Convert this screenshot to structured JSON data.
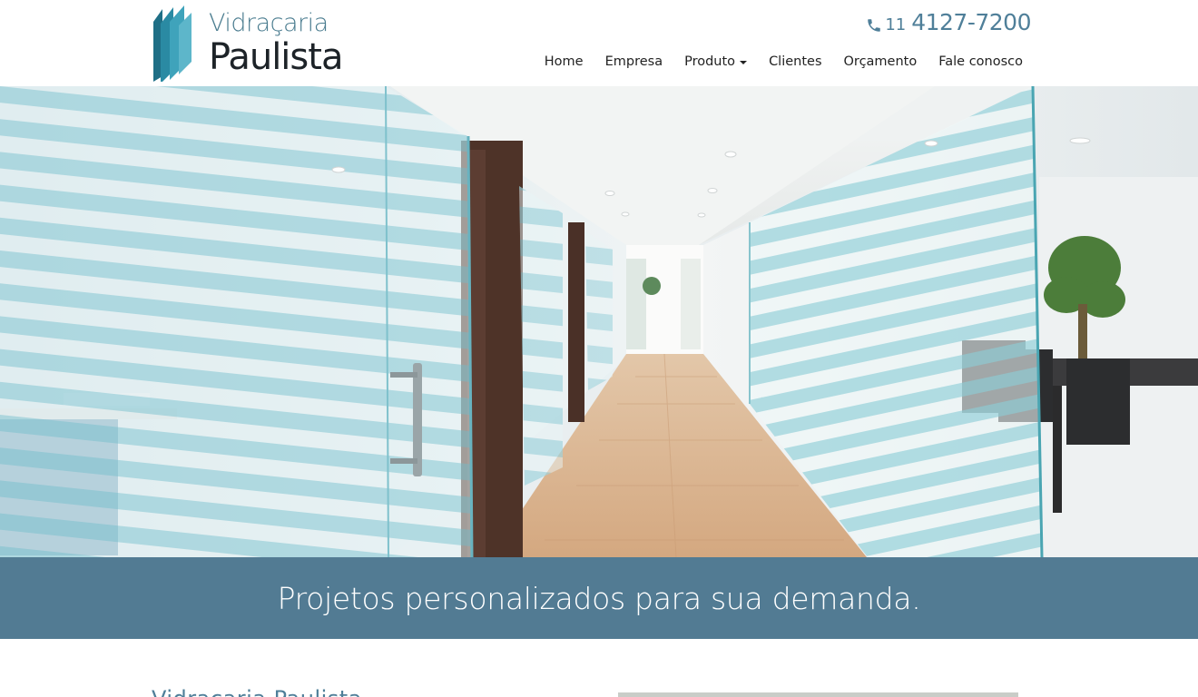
{
  "brand": {
    "line1": "Vidraçaria",
    "line2": "Paulista"
  },
  "contact": {
    "phone_icon": "phone-icon",
    "area_code": "11",
    "number": "4127-7200"
  },
  "nav": {
    "items": [
      {
        "label": "Home",
        "dropdown": false
      },
      {
        "label": "Empresa",
        "dropdown": false
      },
      {
        "label": "Produto",
        "dropdown": true
      },
      {
        "label": "Clientes",
        "dropdown": false
      },
      {
        "label": "Orçamento",
        "dropdown": false
      },
      {
        "label": "Fale conosco",
        "dropdown": false
      }
    ]
  },
  "hero": {
    "image": "office-corridor-with-striped-glass-partitions"
  },
  "banner": {
    "text": "Projetos personalizados para sua demanda."
  },
  "content": {
    "heading": "Vidraçaria Paulista"
  },
  "colors": {
    "accent": "#527b93",
    "phone": "#4f7f99",
    "logo_teal": "#2f8fa6"
  }
}
